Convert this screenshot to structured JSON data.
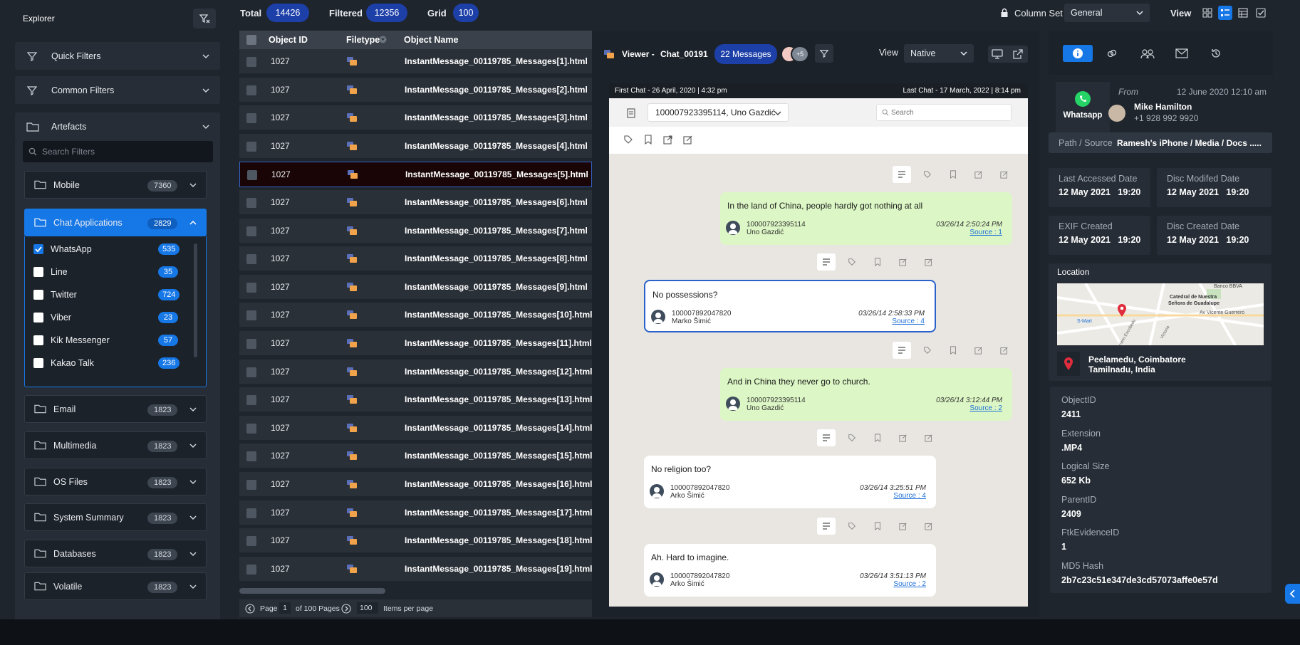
{
  "explorer": {
    "title": "Explorer",
    "quick_filters": "Quick Filters",
    "common_filters": "Common Filters",
    "artefacts": "Artefacts",
    "search_placeholder": "Search Filters",
    "categories": [
      {
        "label": "Mobile",
        "count": "7360"
      },
      {
        "label": "Chat Applications",
        "count": "2829"
      },
      {
        "label": "Email",
        "count": "1823"
      },
      {
        "label": "Multimedia",
        "count": "1823"
      },
      {
        "label": "OS Files",
        "count": "1823"
      },
      {
        "label": "System Summary",
        "count": "1823"
      },
      {
        "label": "Databases",
        "count": "1823"
      },
      {
        "label": "Volatile",
        "count": "1823"
      }
    ],
    "chat_apps": [
      {
        "label": "WhatsApp",
        "count": "535",
        "checked": true
      },
      {
        "label": "Line",
        "count": "35",
        "checked": false
      },
      {
        "label": "Twitter",
        "count": "724",
        "checked": false
      },
      {
        "label": "Viber",
        "count": "23",
        "checked": false
      },
      {
        "label": "Kik Messenger",
        "count": "57",
        "checked": false
      },
      {
        "label": "Kakao Talk",
        "count": "236",
        "checked": false
      }
    ]
  },
  "toolbar": {
    "total_label": "Total",
    "total": "14426",
    "filtered_label": "Filtered",
    "filtered": "12356",
    "grid_label": "Grid",
    "grid": "100",
    "column_set_label": "Column Set",
    "column_set_value": "General",
    "view_label": "View"
  },
  "grid": {
    "columns": [
      "Object ID",
      "Filetype",
      "Object Name"
    ],
    "rows": [
      {
        "id": "1027",
        "name": "InstantMessage_00119785_Messages[1].html"
      },
      {
        "id": "1027",
        "name": "InstantMessage_00119785_Messages[2].html"
      },
      {
        "id": "1027",
        "name": "InstantMessage_00119785_Messages[3].html"
      },
      {
        "id": "1027",
        "name": "InstantMessage_00119785_Messages[4].html"
      },
      {
        "id": "1027",
        "name": "InstantMessage_00119785_Messages[5].html"
      },
      {
        "id": "1027",
        "name": "InstantMessage_00119785_Messages[6].html"
      },
      {
        "id": "1027",
        "name": "InstantMessage_00119785_Messages[7].html"
      },
      {
        "id": "1027",
        "name": "InstantMessage_00119785_Messages[8].html"
      },
      {
        "id": "1027",
        "name": "InstantMessage_00119785_Messages[9].html"
      },
      {
        "id": "1027",
        "name": "InstantMessage_00119785_Messages[10].html"
      },
      {
        "id": "1027",
        "name": "InstantMessage_00119785_Messages[11].html"
      },
      {
        "id": "1027",
        "name": "InstantMessage_00119785_Messages[12].html"
      },
      {
        "id": "1027",
        "name": "InstantMessage_00119785_Messages[13].html"
      },
      {
        "id": "1027",
        "name": "InstantMessage_00119785_Messages[14].html"
      },
      {
        "id": "1027",
        "name": "InstantMessage_00119785_Messages[15].html"
      },
      {
        "id": "1027",
        "name": "InstantMessage_00119785_Messages[16].html"
      },
      {
        "id": "1027",
        "name": "InstantMessage_00119785_Messages[17].html"
      },
      {
        "id": "1027",
        "name": "InstantMessage_00119785_Messages[18].html"
      },
      {
        "id": "1027",
        "name": "InstantMessage_00119785_Messages[19].html"
      }
    ],
    "pager": {
      "page_label": "Page",
      "page": "1",
      "of_pages": "of 100 Pages",
      "per_page": "100",
      "per_page_label": "Items per page"
    }
  },
  "viewer": {
    "title": "Viewer -",
    "chat_name": "Chat_00191",
    "messages_badge": "22 Messages",
    "more_participants": "+5",
    "view_label": "View",
    "view_value": "Native",
    "first_chat": "First Chat - 26 April, 2020  |  4:32 pm",
    "last_chat": "Last Chat - 17 March, 2022  |  8:14 pm",
    "participants": "100007923395114, Uno Gazdić",
    "search_placeholder": "Search",
    "messages": [
      {
        "text": "In the land of China, people hardly got nothing at all",
        "uid": "100007923395114",
        "user": "Uno Gazdić",
        "time": "03/26/14 2:50:24 PM",
        "source": "Source : 1"
      },
      {
        "text": "No possessions?",
        "uid": "100007892047820",
        "user": "Marko Šimić",
        "time": "03/26/14 2:58:33 PM",
        "source": "Source : 4"
      },
      {
        "text": "And in China they never go to church.",
        "uid": "100007923395114",
        "user": "Uno Gazdić",
        "time": "03/26/14 3:12:44 PM",
        "source": "Source : 2"
      },
      {
        "text": "No religion too?",
        "uid": "100007892047820",
        "user": "Arko Šimić",
        "time": "03/26/14 3:25:51 PM",
        "source": "Source : 4"
      },
      {
        "text": "Ah. Hard to imagine.",
        "uid": "100007892047820",
        "user": "Arko Šimić",
        "time": "03/26/14 3:51:13 PM",
        "source": "Source : 2"
      }
    ]
  },
  "properties": {
    "app": "Whatsapp",
    "from_label": "From",
    "from_date": "12 June 2020 12:10 am",
    "from_name": "Mike Hamilton",
    "from_phone": "+1 928 992 9920",
    "path_label": "Path / Source",
    "path_value": "Ramesh's iPhone / Media / Docs .....",
    "dates": [
      {
        "label": "Last Accessed Date",
        "value": "12 May 2021   19:20"
      },
      {
        "label": "Disc Modifed Date",
        "value": "12 May 2021   19:20"
      },
      {
        "label": "EXIF Created",
        "value": "12 May 2021   19:20"
      },
      {
        "label": "Disc Created Date",
        "value": "12 May 2021   19:20"
      }
    ],
    "location_label": "Location",
    "location_line1": "Peelamedu, Coimbatore",
    "location_line2": "Tamilnadu, India",
    "map_labels": {
      "bank": "Banco BBVA",
      "church1": "Catedral de Nuestra",
      "church2": "Señora de Guadalupe",
      "avenue": "Av Vicente Guerrero",
      "smart": "S-Mart",
      "st1": "Mariano Escobedo",
      "st2": "Victoria"
    },
    "details": [
      {
        "label": "ObjectID",
        "value": "2411"
      },
      {
        "label": "Extension",
        "value": ".MP4"
      },
      {
        "label": "Logical Size",
        "value": "652 Kb"
      },
      {
        "label": "ParentID",
        "value": "2409"
      },
      {
        "label": "FtkEvidenceID",
        "value": "1"
      },
      {
        "label": "MD5 Hash",
        "value": "2b7c23c51e347de3cd57073affe0e57d"
      }
    ]
  },
  "colors": {
    "accent": "#1677e6",
    "pill": "#1d3fa8",
    "outgoing_bubble": "#dcf7c5",
    "whatsapp": "#25d366"
  }
}
